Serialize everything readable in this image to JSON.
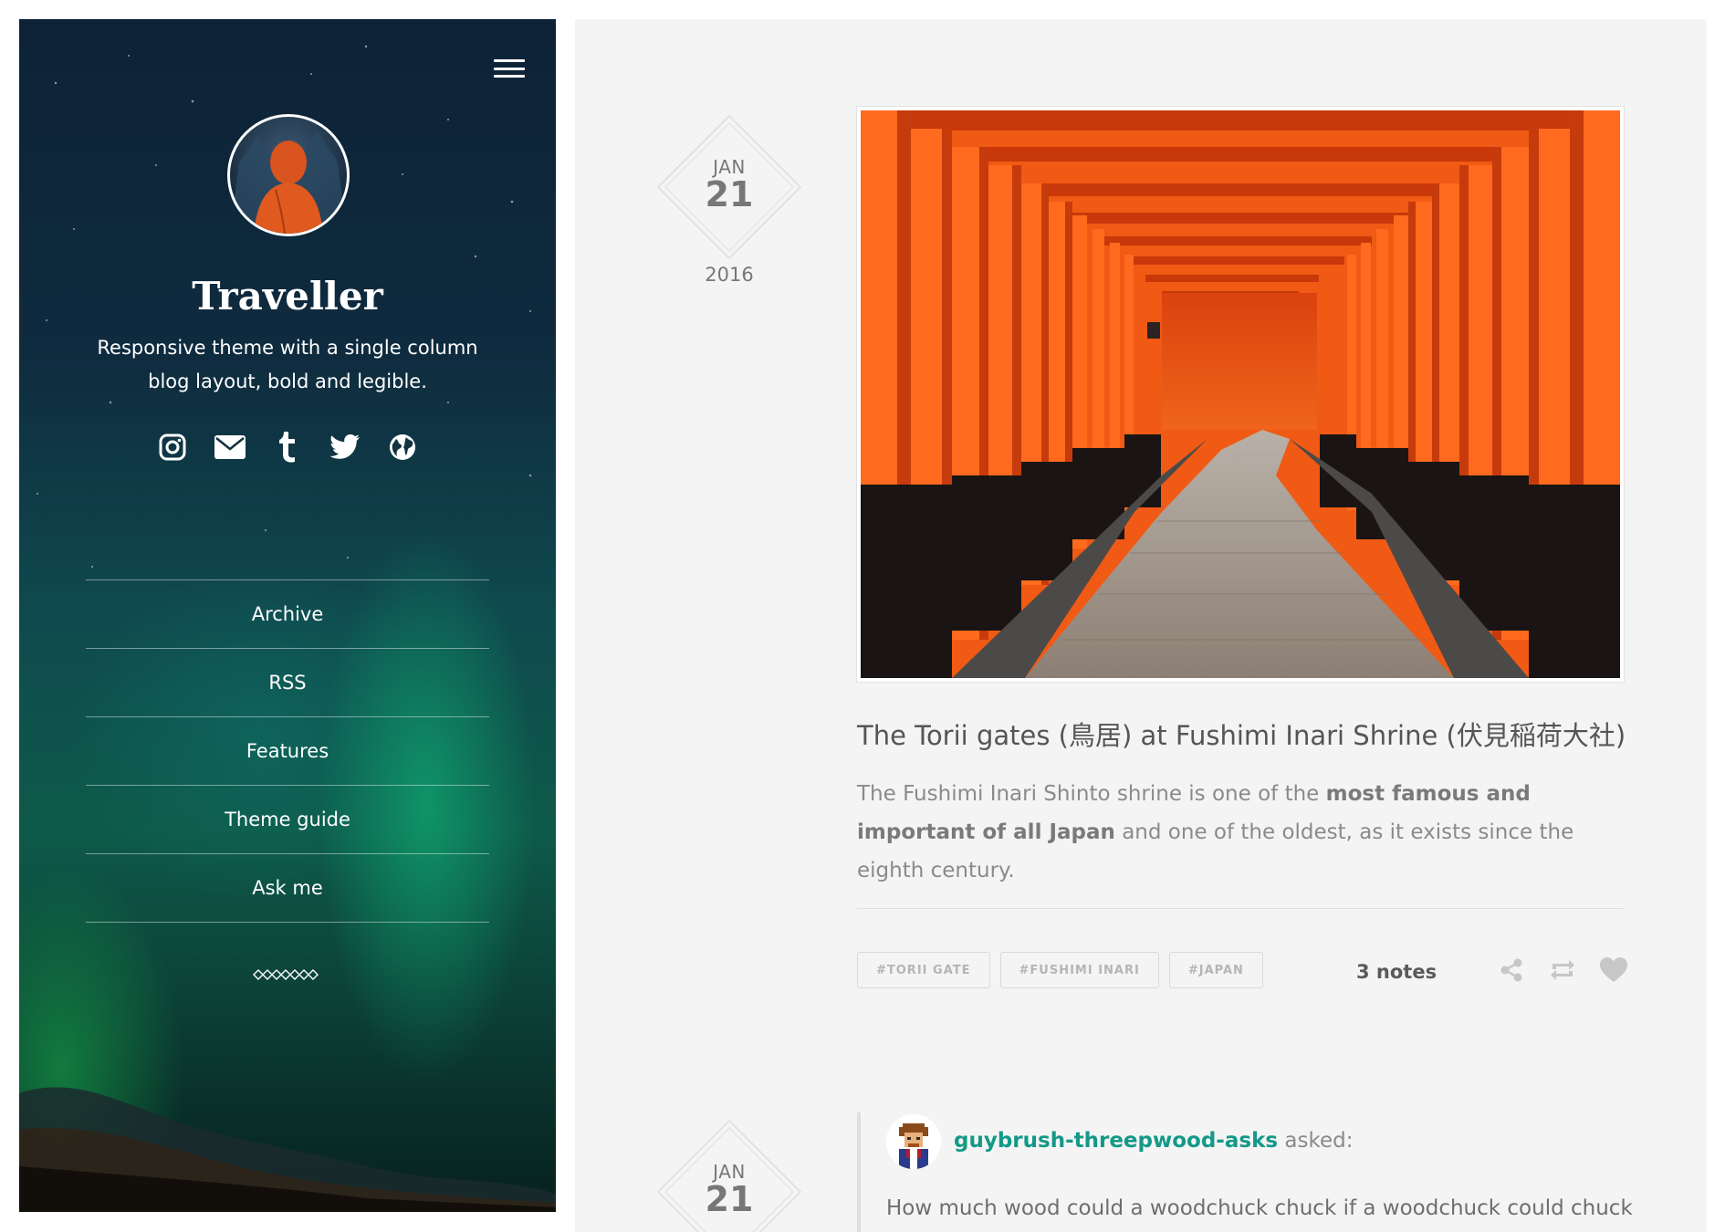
{
  "sidebar": {
    "menu_icon": "hamburger-icon",
    "title": "Traveller",
    "description": "Responsive theme with a single column blog layout, bold and legible.",
    "social_icons": [
      "instagram-icon",
      "mail-icon",
      "tumblr-icon",
      "twitter-icon",
      "globe-icon"
    ],
    "nav": [
      "Archive",
      "RSS",
      "Features",
      "Theme guide",
      "Ask me"
    ],
    "ornament_icon": "chain-ornament-icon"
  },
  "posts": [
    {
      "date": {
        "month": "JAN",
        "day": "21",
        "year": "2016"
      },
      "title": "The Torii gates (鳥居) at Fushimi Inari Shrine (伏見稲荷大社)",
      "body": {
        "before": "The Fushimi Inari Shinto shrine is one of the ",
        "bold": "most famous and important of all Japan",
        "after": " and one of the oldest, as it exists since the eighth century."
      },
      "tags": [
        "#TORII GATE",
        "#FUSHIMI INARI",
        "#JAPAN"
      ],
      "notes": "3 notes",
      "actions": [
        "share-icon",
        "reblog-icon",
        "heart-icon"
      ]
    },
    {
      "date": {
        "month": "JAN",
        "day": "21"
      },
      "asker": "guybrush-threepwood-asks",
      "asked_label": " asked:",
      "question": "How much wood could a woodchuck chuck if a woodchuck could chuck"
    }
  ],
  "colors": {
    "accent_link": "#139988",
    "torii_orange": "#f05a14",
    "main_bg": "#f4f4f4"
  }
}
